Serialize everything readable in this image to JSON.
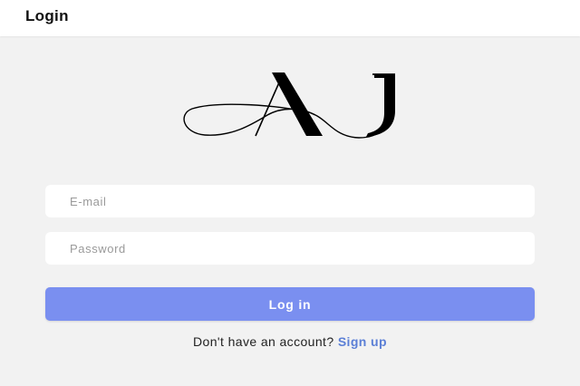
{
  "header": {
    "title": "Login"
  },
  "logo": {
    "text": "AJ"
  },
  "form": {
    "email_placeholder": "E-mail",
    "email_value": "",
    "password_placeholder": "Password",
    "password_value": "",
    "login_label": "Log in"
  },
  "signup": {
    "prompt": "Don't have an account?",
    "link_label": "Sign up"
  },
  "colors": {
    "accent": "#7a8ff0",
    "link": "#5b7fd6",
    "background": "#f2f2f2"
  }
}
